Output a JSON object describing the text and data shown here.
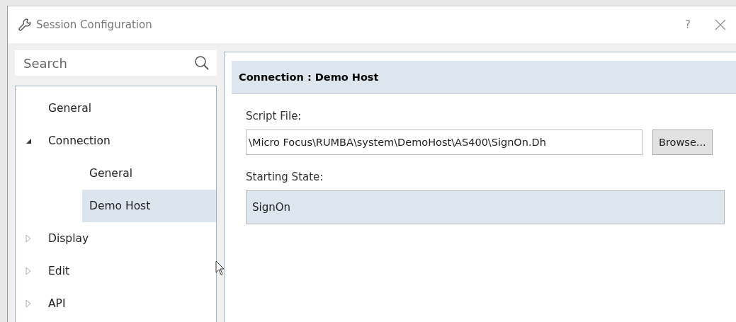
{
  "window": {
    "title": "Session Configuration",
    "help": "?"
  },
  "search": {
    "placeholder": "Search"
  },
  "tree": [
    {
      "label": "General",
      "selected": false
    },
    {
      "label": "Connection",
      "selected": false,
      "expanded": true,
      "children": [
        {
          "label": "General",
          "selected": false
        },
        {
          "label": "Demo Host",
          "selected": true
        }
      ]
    },
    {
      "label": "Display",
      "selected": false,
      "expanded": false
    },
    {
      "label": "Edit",
      "selected": false,
      "expanded": false
    },
    {
      "label": "API",
      "selected": false,
      "expanded": false
    }
  ],
  "panel": {
    "header": "Connection : Demo Host",
    "script_file": {
      "label": "Script File:",
      "value": "\\Micro Focus\\RUMBA\\system\\DemoHost\\AS400\\SignOn.Dh",
      "button": "Browse..."
    },
    "starting_state": {
      "label": "Starting State:",
      "value": "SignOn"
    }
  }
}
